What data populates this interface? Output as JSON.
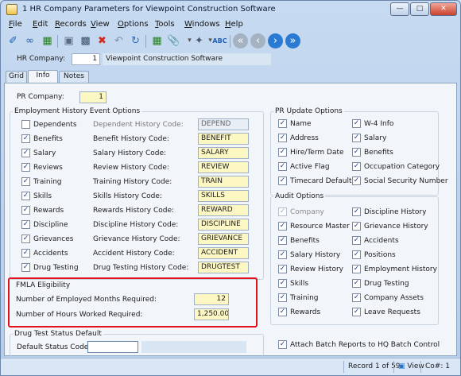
{
  "window": {
    "title": "1 HR Company Parameters for Viewpoint Construction Software"
  },
  "menu": [
    {
      "u": "F",
      "rest": "ile"
    },
    {
      "u": "E",
      "rest": "dit"
    },
    {
      "u": "R",
      "rest": "ecords"
    },
    {
      "u": "V",
      "rest": "iew"
    },
    {
      "u": "O",
      "rest": "ptions"
    },
    {
      "u": "T",
      "rest": "ools"
    },
    {
      "u": "W",
      "rest": "indows"
    },
    {
      "u": "H",
      "rest": "elp"
    }
  ],
  "header": {
    "hr_company_label": "HR Company:",
    "hr_company_value": "1",
    "company_name": "Viewpoint Construction Software"
  },
  "tabs": [
    "Grid",
    "Info",
    "Notes"
  ],
  "pr_company": {
    "label": "PR Company:",
    "value": "1"
  },
  "employment_history": {
    "title": "Employment History Event Options",
    "rows": [
      {
        "check": "Dependents",
        "checked": false,
        "code_label": "Dependent History Code:",
        "code": "DEPEND",
        "disabled": true
      },
      {
        "check": "Benefits",
        "checked": true,
        "code_label": "Benefit History Code:",
        "code": "BENEFIT"
      },
      {
        "check": "Salary",
        "checked": true,
        "code_label": "Salary History Code:",
        "code": "SALARY"
      },
      {
        "check": "Reviews",
        "checked": true,
        "code_label": "Review History Code:",
        "code": "REVIEW"
      },
      {
        "check": "Training",
        "checked": true,
        "code_label": "Training History Code:",
        "code": "TRAIN"
      },
      {
        "check": "Skills",
        "checked": true,
        "code_label": "Skills History Code:",
        "code": "SKILLS"
      },
      {
        "check": "Rewards",
        "checked": true,
        "code_label": "Rewards History Code:",
        "code": "REWARD"
      },
      {
        "check": "Discipline",
        "checked": true,
        "code_label": "Discipline History Code:",
        "code": "DISCIPLINE"
      },
      {
        "check": "Grievances",
        "checked": true,
        "code_label": "Grievance History Code:",
        "code": "GRIEVANCE"
      },
      {
        "check": "Accidents",
        "checked": true,
        "code_label": "Accident History Code:",
        "code": "ACCIDENT"
      },
      {
        "check": "Drug Testing",
        "checked": true,
        "code_label": "Drug Testing History Code:",
        "code": "DRUGTEST"
      }
    ]
  },
  "fmla": {
    "title": "FMLA Eligibility",
    "months_label": "Number of Employed Months Required:",
    "months_value": "12",
    "hours_label": "Number of Hours Worked Required:",
    "hours_value": "1,250.00"
  },
  "drug_test": {
    "title": "Drug Test Status Default",
    "status_label": "Default Status Code:",
    "status_value": ""
  },
  "pr_update": {
    "title": "PR Update Options",
    "left": [
      "Name",
      "Address",
      "Hire/Term Date",
      "Active Flag",
      "Timecard Defaults"
    ],
    "right": [
      "W-4 Info",
      "Salary",
      "Benefits",
      "Occupation Category",
      "Social Security Number"
    ]
  },
  "audit": {
    "title": "Audit Options",
    "left": [
      "Company",
      "Resource Master",
      "Benefits",
      "Salary History",
      "Review History",
      "Skills",
      "Training",
      "Rewards"
    ],
    "right": [
      "Discipline  History",
      "Grievance  History",
      "Accidents",
      "Positions",
      "Employment  History",
      "Drug Testing",
      "Company Assets",
      "Leave Requests"
    ]
  },
  "attach_batch": "Attach Batch Reports to HQ Batch Control",
  "status": {
    "record": "Record 1 of 59",
    "view": "View",
    "co": "Co#: 1"
  },
  "colors": {
    "highlight": "#e4111a",
    "field_yellow": "#fdf7c4"
  }
}
